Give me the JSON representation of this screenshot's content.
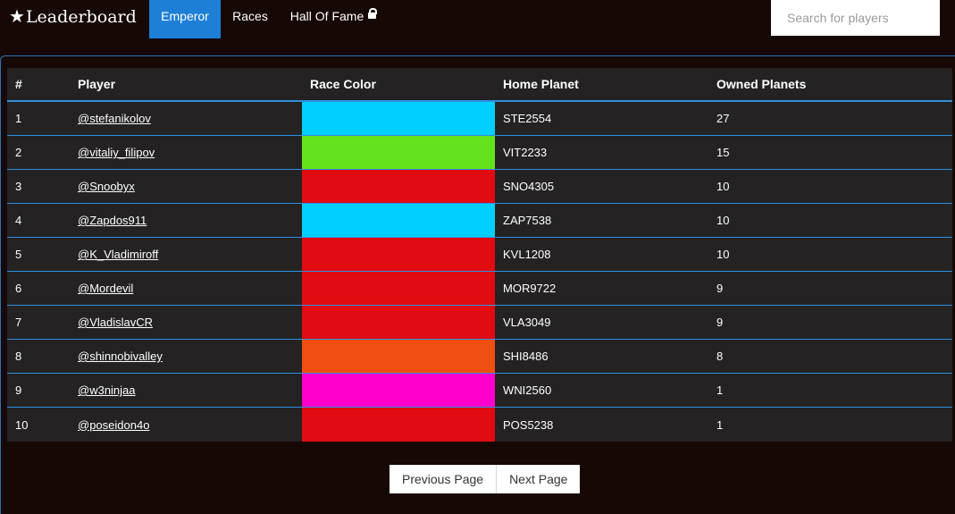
{
  "brand": {
    "star": "★",
    "title": "Leaderboard"
  },
  "nav": {
    "items": [
      {
        "label": "Emperor",
        "active": true
      },
      {
        "label": "Races",
        "active": false
      },
      {
        "label": "Hall Of Fame",
        "active": false,
        "icon": "lock-icon"
      }
    ]
  },
  "search": {
    "placeholder": "Search for players",
    "value": ""
  },
  "table": {
    "headers": [
      "#",
      "Player",
      "Race Color",
      "Home Planet",
      "Owned Planets"
    ],
    "rows": [
      {
        "rank": "1",
        "player": "@stefanikolov",
        "race_color": "#00cfff",
        "home_planet": "STE2554",
        "owned_planets": "27"
      },
      {
        "rank": "2",
        "player": "@vitaliy_filipov",
        "race_color": "#63e31b",
        "home_planet": "VIT2233",
        "owned_planets": "15"
      },
      {
        "rank": "3",
        "player": "@Snoobyx",
        "race_color": "#e10b12",
        "home_planet": "SNO4305",
        "owned_planets": "10"
      },
      {
        "rank": "4",
        "player": "@Zapdos911",
        "race_color": "#00cfff",
        "home_planet": "ZAP7538",
        "owned_planets": "10"
      },
      {
        "rank": "5",
        "player": "@K_Vladimiroff",
        "race_color": "#e10b12",
        "home_planet": "KVL1208",
        "owned_planets": "10"
      },
      {
        "rank": "6",
        "player": "@Mordevil",
        "race_color": "#e10b12",
        "home_planet": "MOR9722",
        "owned_planets": "9"
      },
      {
        "rank": "7",
        "player": "@VladislavCR",
        "race_color": "#e10b12",
        "home_planet": "VLA3049",
        "owned_planets": "9"
      },
      {
        "rank": "8",
        "player": "@shinnobivalley",
        "race_color": "#f04f12",
        "home_planet": "SHI8486",
        "owned_planets": "8"
      },
      {
        "rank": "9",
        "player": "@w3ninjaa",
        "race_color": "#ff00cc",
        "home_planet": "WNI2560",
        "owned_planets": "1"
      },
      {
        "rank": "10",
        "player": "@poseidon4o",
        "race_color": "#e10b12",
        "home_planet": "POS5238",
        "owned_planets": "1"
      }
    ]
  },
  "pager": {
    "prev_label": "Previous Page",
    "next_label": "Next Page"
  },
  "colors": {
    "background": "#160804",
    "accent": "#1e7fd6",
    "table_bg": "#242223",
    "row_border": "#2e8fe0"
  }
}
